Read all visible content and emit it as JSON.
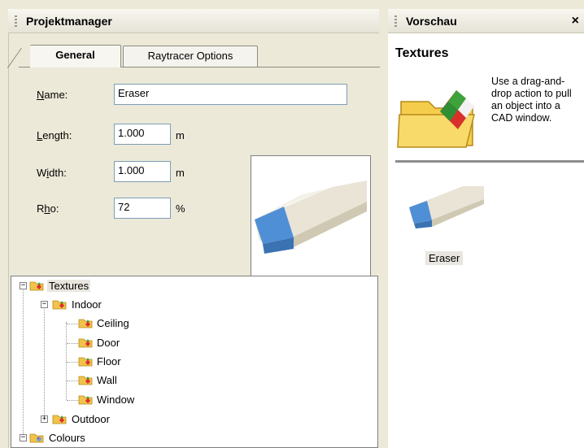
{
  "project_manager": {
    "title": "Projektmanager",
    "tabs": [
      {
        "label": "General"
      },
      {
        "label": "Raytracer Options"
      }
    ],
    "fields": {
      "name": {
        "label_ul": "N",
        "label_rest": "ame:",
        "value": "Eraser"
      },
      "length": {
        "label_ul": "L",
        "label_rest": "ength:",
        "value": "1.000",
        "unit": "m"
      },
      "width": {
        "label_pre": "W",
        "label_ul": "i",
        "label_rest": "dth:",
        "value": "1.000",
        "unit": "m"
      },
      "rho": {
        "label_pre": "R",
        "label_ul": "h",
        "label_rest": "o:",
        "value": "72",
        "unit": "%"
      }
    },
    "tree": [
      {
        "label": "Textures"
      },
      {
        "label": "Indoor"
      },
      {
        "label": "Ceiling"
      },
      {
        "label": "Door"
      },
      {
        "label": "Floor"
      },
      {
        "label": "Wall"
      },
      {
        "label": "Window"
      },
      {
        "label": "Outdoor"
      },
      {
        "label": "Colours"
      }
    ]
  },
  "preview": {
    "title": "Vorschau",
    "close": "×",
    "heading": "Textures",
    "description": "Use a drag-and-drop action to pull an object into a CAD window.",
    "item_caption": "Eraser"
  },
  "icons": {
    "folder": "folder-icon",
    "close": "close-icon",
    "eraser": "eraser-icon"
  }
}
